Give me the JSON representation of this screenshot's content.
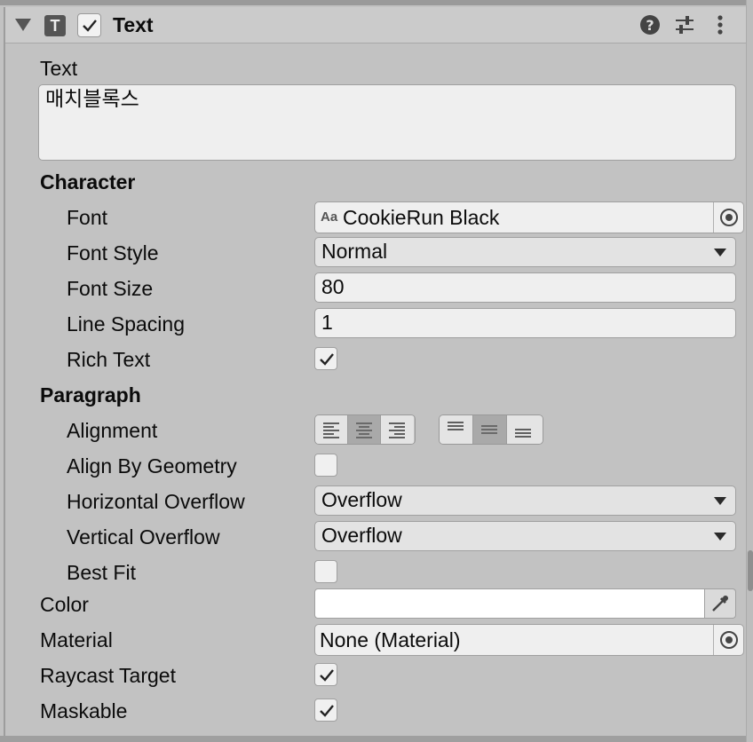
{
  "header": {
    "component_icon_letter": "T",
    "enabled": true,
    "title": "Text"
  },
  "text_section": {
    "label": "Text",
    "value": "매치블록스"
  },
  "character": {
    "heading": "Character",
    "font": {
      "label": "Font",
      "icon_text": "Aa",
      "value": "CookieRun Black"
    },
    "font_style": {
      "label": "Font Style",
      "value": "Normal"
    },
    "font_size": {
      "label": "Font Size",
      "value": "80"
    },
    "line_spacing": {
      "label": "Line Spacing",
      "value": "1"
    },
    "rich_text": {
      "label": "Rich Text",
      "checked": true
    }
  },
  "paragraph": {
    "heading": "Paragraph",
    "alignment": {
      "label": "Alignment",
      "horizontal_selected": "center",
      "vertical_selected": "middle"
    },
    "align_by_geometry": {
      "label": "Align By Geometry",
      "checked": false
    },
    "horizontal_overflow": {
      "label": "Horizontal Overflow",
      "value": "Overflow"
    },
    "vertical_overflow": {
      "label": "Vertical Overflow",
      "value": "Overflow"
    },
    "best_fit": {
      "label": "Best Fit",
      "checked": false
    }
  },
  "color": {
    "label": "Color",
    "value": "#FFFFFF"
  },
  "material": {
    "label": "Material",
    "value": "None (Material)"
  },
  "raycast_target": {
    "label": "Raycast Target",
    "checked": true
  },
  "maskable": {
    "label": "Maskable",
    "checked": true
  },
  "icons": [
    "foldout-arrow-icon",
    "text-component-icon",
    "help-icon",
    "presets-icon",
    "kebab-menu-icon",
    "object-picker-icon",
    "eyedropper-icon"
  ]
}
